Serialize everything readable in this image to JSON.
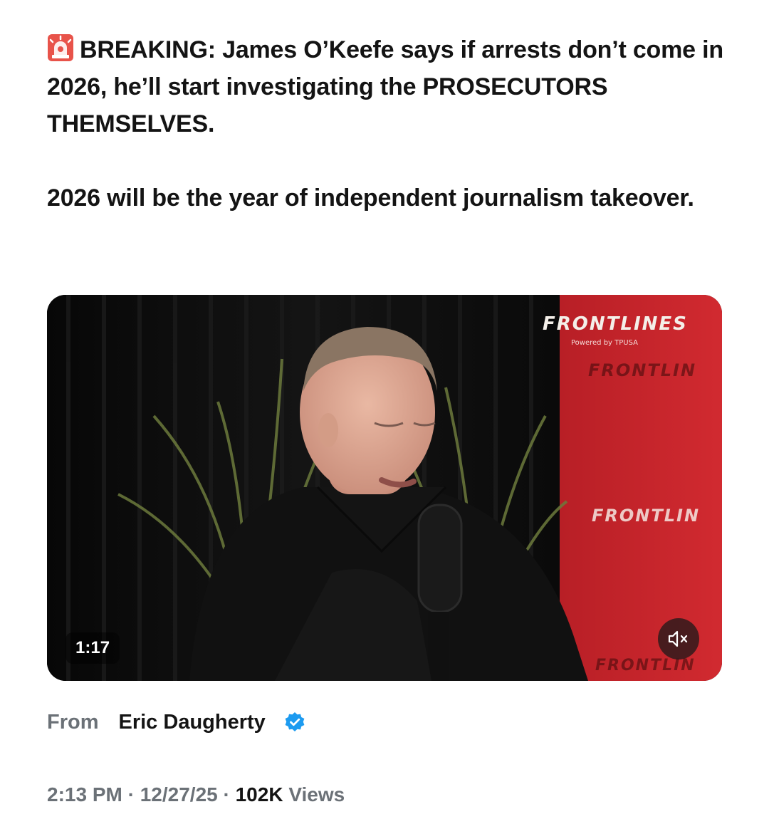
{
  "tweet": {
    "headline_icon": "siren-emoji-icon",
    "paragraph1": "BREAKING: James O’Keefe says if arrests don’t come in 2026, he’ll start investigating the PROSECUTORS THEMSELVES.",
    "paragraph2": "2026 will be the year of independent journalism takeover."
  },
  "video": {
    "brand": "FRONTLINES",
    "brand_sub": "Powered by TPUSA",
    "ghost_brand": "FRONTLIN",
    "duration": "1:17",
    "mute_icon": "speaker-muted-icon",
    "colors": {
      "backdrop_red": "#c8232a",
      "curtain": "#111111"
    }
  },
  "attribution": {
    "from_label": "From",
    "author_name": "Eric Daugherty",
    "verified_icon": "verified-badge-icon",
    "verified_color": "#1d9bf0"
  },
  "meta": {
    "time": "2:13 PM",
    "separator": "·",
    "date": "12/27/25",
    "views_count": "102K",
    "views_label": "Views"
  }
}
